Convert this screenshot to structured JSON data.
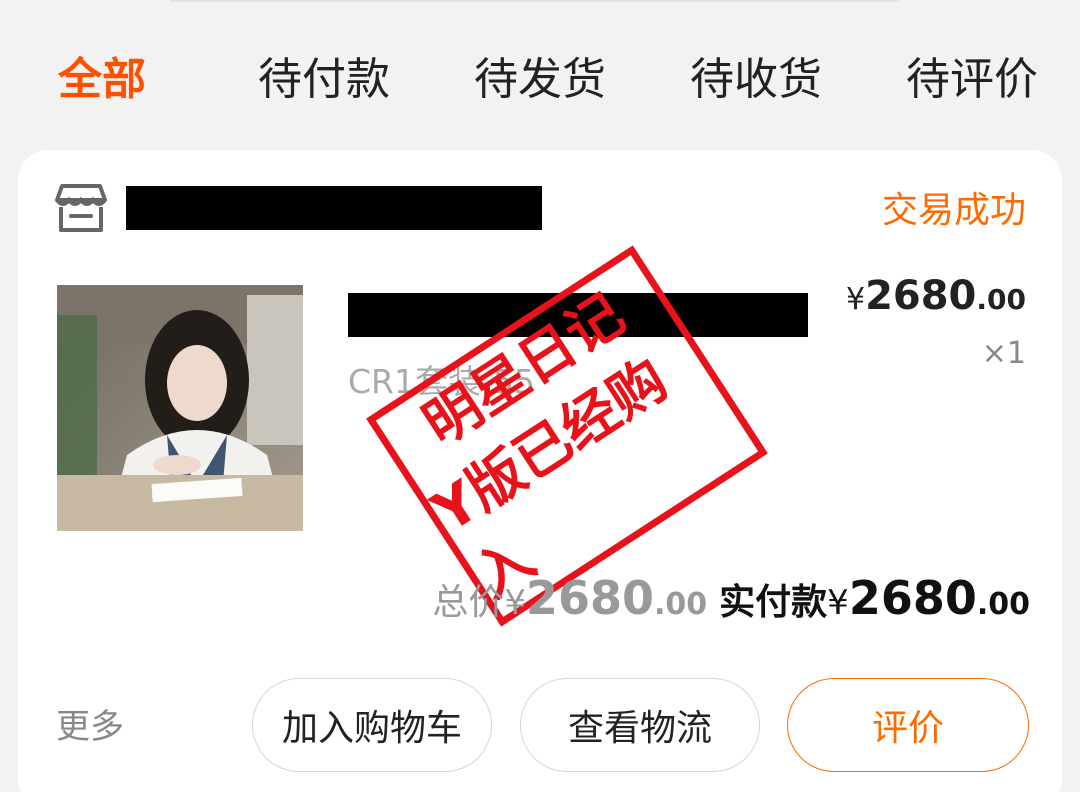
{
  "tabs": [
    {
      "label": "全部",
      "active": true
    },
    {
      "label": "待付款"
    },
    {
      "label": "待发货"
    },
    {
      "label": "待收货"
    },
    {
      "label": "待评价"
    }
  ],
  "order": {
    "status": "交易成功",
    "store_icon": "store-icon",
    "product": {
      "spec": "CR1套装-55",
      "price": {
        "currency": "¥",
        "integer": "2680",
        "decimal": ".00"
      },
      "quantity": "×1"
    },
    "stamp": {
      "line1": "明星日记",
      "line2": "Y版已经购入"
    },
    "total": {
      "label": "总价",
      "currency": "¥",
      "integer": "2680",
      "decimal": ".00"
    },
    "paid": {
      "label": "实付款",
      "currency": "¥",
      "integer": "2680",
      "decimal": ".00"
    }
  },
  "actions": {
    "more": "更多",
    "add_to_cart": "加入购物车",
    "view_logistics": "查看物流",
    "review": "评价"
  },
  "colors": {
    "accent": "#ff5000",
    "status": "#ff6a00",
    "stamp": "#e8121b"
  }
}
